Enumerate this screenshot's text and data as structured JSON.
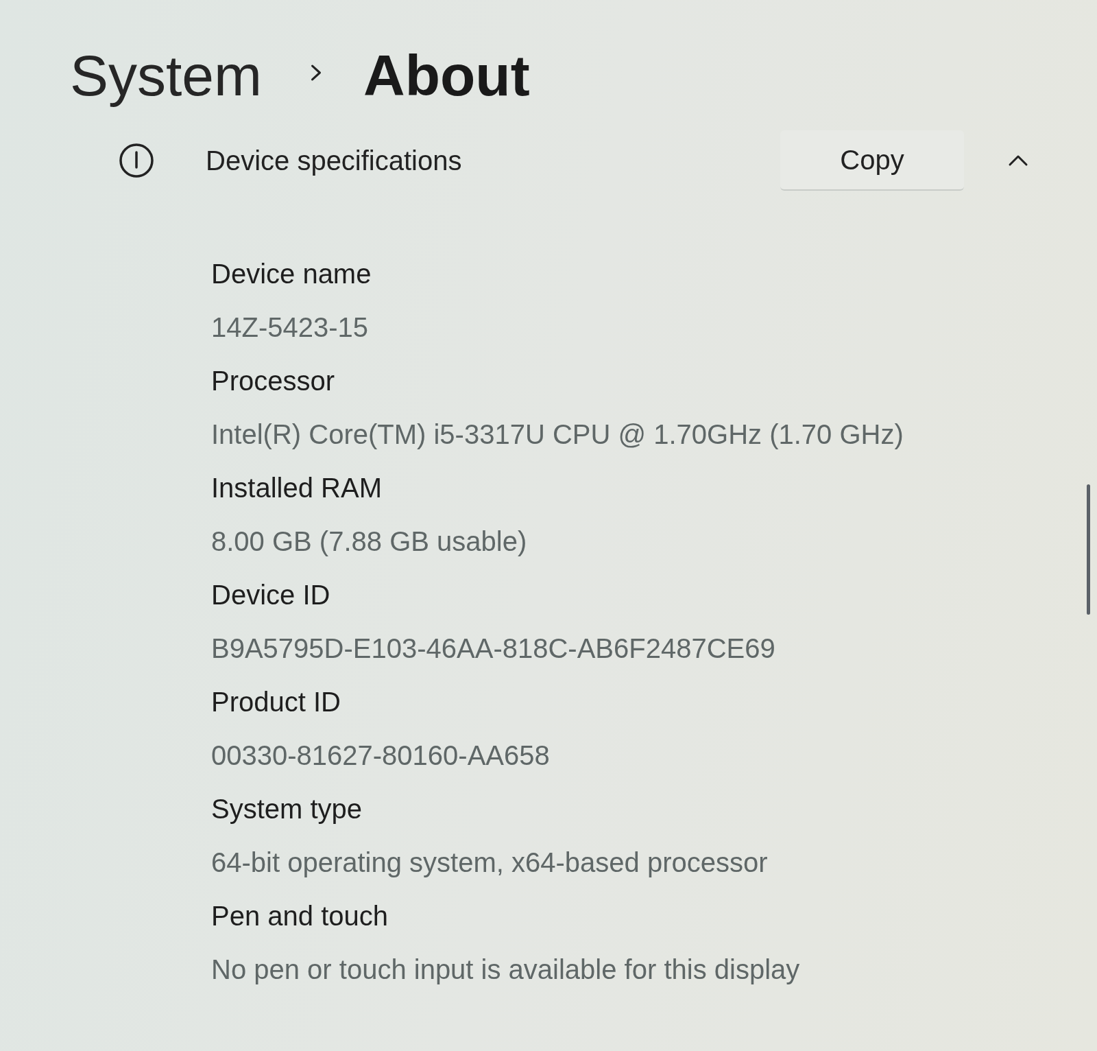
{
  "breadcrumb": {
    "parent": "System",
    "current": "About"
  },
  "section": {
    "title": "Device specifications",
    "copy_button": "Copy",
    "expanded": true
  },
  "specs": [
    {
      "label": "Device name",
      "value": "14Z-5423-15"
    },
    {
      "label": "Processor",
      "value": "Intel(R) Core(TM) i5-3317U CPU @ 1.70GHz (1.70 GHz)"
    },
    {
      "label": "Installed RAM",
      "value": "8.00 GB (7.88 GB usable)"
    },
    {
      "label": "Device ID",
      "value": "B9A5795D-E103-46AA-818C-AB6F2487CE69"
    },
    {
      "label": "Product ID",
      "value": "00330-81627-80160-AA658"
    },
    {
      "label": "System type",
      "value": "64-bit operating system, x64-based processor"
    },
    {
      "label": "Pen and touch",
      "value": "No pen or touch input is available for this display"
    }
  ]
}
